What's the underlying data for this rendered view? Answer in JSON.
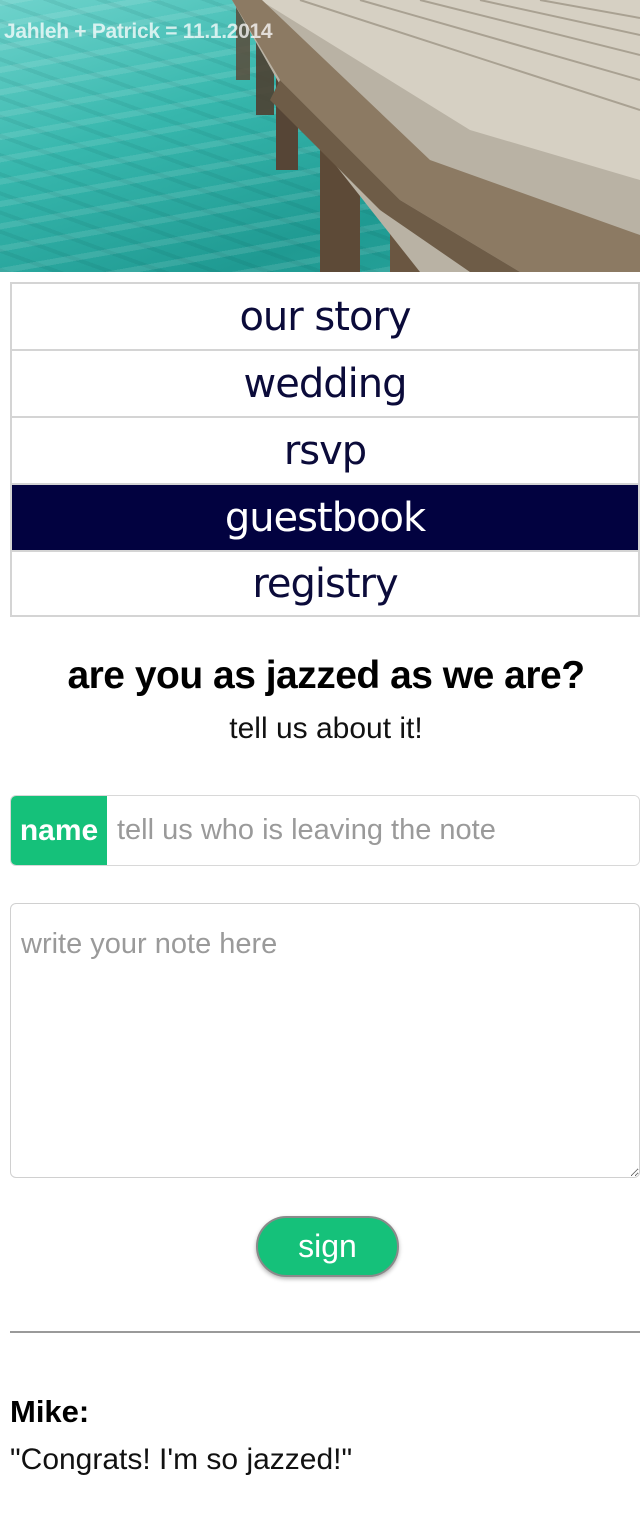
{
  "hero": {
    "title": "Jahleh + Patrick = 11.1.2014"
  },
  "nav": {
    "items": [
      {
        "label": "our story",
        "active": false
      },
      {
        "label": "wedding",
        "active": false
      },
      {
        "label": "rsvp",
        "active": false
      },
      {
        "label": "guestbook",
        "active": true
      },
      {
        "label": "registry",
        "active": false
      }
    ]
  },
  "guestbook": {
    "headline": "are you as jazzed as we are?",
    "subline": "tell us about it!",
    "name_label": "name",
    "name_placeholder": "tell us who is leaving the note",
    "name_value": "",
    "note_placeholder": "write your note here",
    "note_value": "",
    "sign_label": "sign"
  },
  "entries": [
    {
      "name": "Mike:",
      "message": "\"Congrats! I'm so jazzed!\""
    }
  ],
  "colors": {
    "accent_green": "#15c17a",
    "nav_active": "#020240",
    "nav_text": "#0b0b3a"
  }
}
